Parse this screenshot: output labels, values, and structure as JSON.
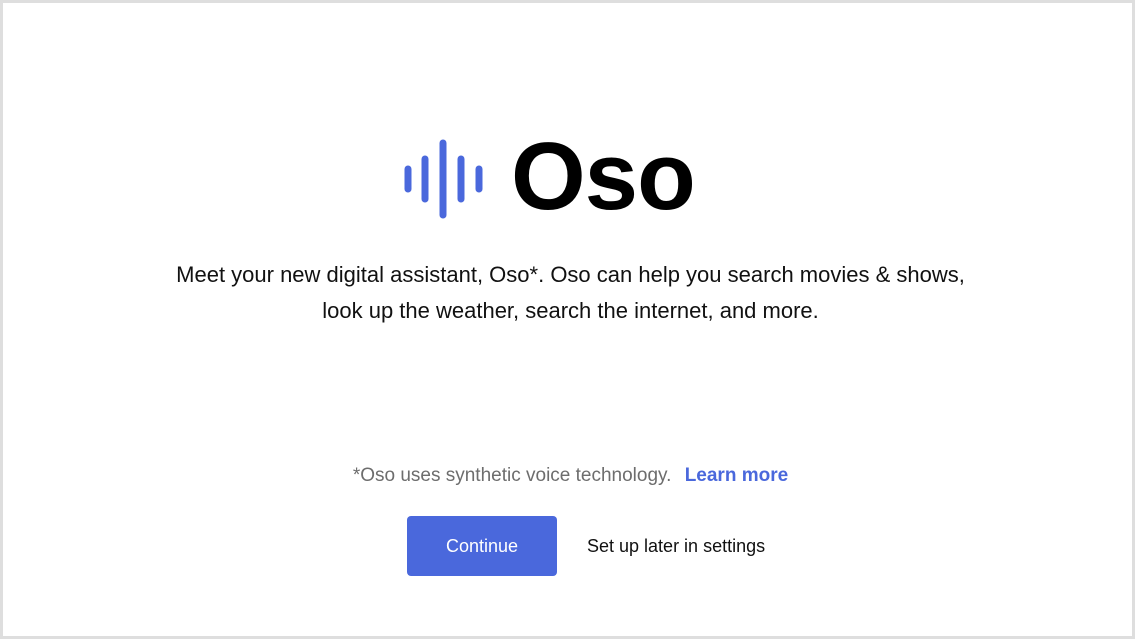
{
  "brand": {
    "name": "Oso",
    "logo_icon": "sound-wave-icon",
    "accent_color": "#4a68dc"
  },
  "intro": {
    "text": "Meet your new digital assistant, Oso*. Oso can help you search movies & shows, look up the weather, search the internet, and more."
  },
  "disclaimer": {
    "text": "*Oso uses synthetic voice technology.",
    "link_label": "Learn more"
  },
  "actions": {
    "continue_label": "Continue",
    "later_label": "Set up later in settings"
  }
}
